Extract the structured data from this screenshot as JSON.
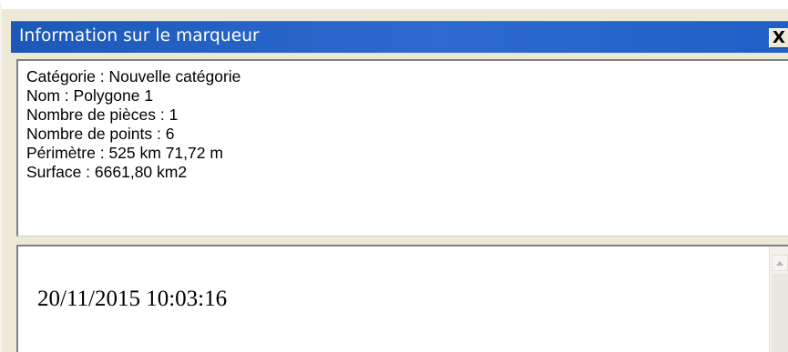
{
  "window": {
    "title": "Information sur le marqueur",
    "close_label": "X"
  },
  "info": {
    "lines": [
      "Catégorie : Nouvelle catégorie",
      "Nom : Polygone 1",
      "Nombre de pièces : 1",
      "Nombre de points : 6",
      "Périmètre : 525 km 71,72 m",
      "Surface : 6661,80 km2"
    ]
  },
  "notes": {
    "timestamp": "20/11/2015 10:03:16"
  },
  "icons": {
    "close": "close-icon",
    "scroll_up": "scroll-up-arrow-icon"
  },
  "colors": {
    "titlebar": "#2d6bd1",
    "window_bg": "#ece9d8"
  }
}
